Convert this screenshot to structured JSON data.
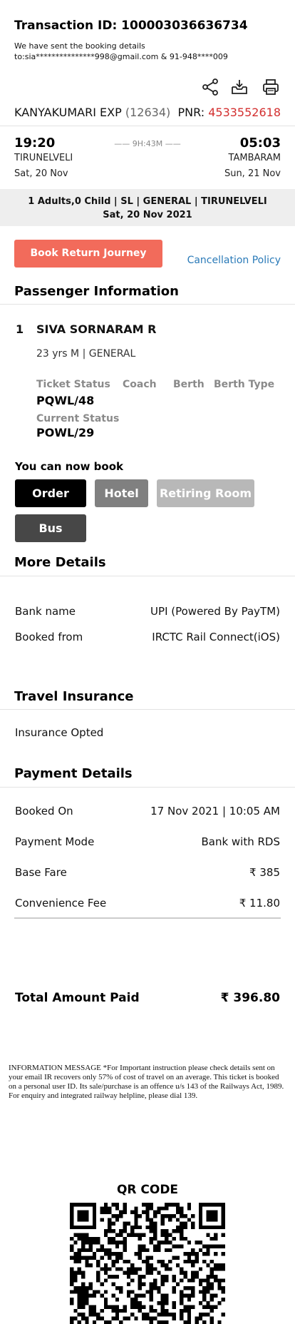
{
  "header": {
    "transaction_label": "Transaction ID: 100003036636734",
    "sent_line1": "We have sent the booking details",
    "sent_line2": "to:sia***************998@gmail.com & 91-948****009"
  },
  "actions": {
    "share_icon": "share-icon",
    "download_icon": "download-icon",
    "print_icon": "print-icon"
  },
  "train": {
    "name": "KANYAKUMARI EXP",
    "number": "(12634)",
    "pnr_label": "PNR: ",
    "pnr": "4533552618"
  },
  "journey": {
    "depart_time": "19:20",
    "arrive_time": "05:03",
    "duration": "—— 9H:43M ——",
    "from_station": "TIRUNELVELI",
    "to_station": "TAMBARAM",
    "depart_date": "Sat, 20 Nov",
    "arrive_date": "Sun, 21 Nov"
  },
  "summary": {
    "line1": "1 Adults,0 Child | SL | GENERAL | TIRUNELVELI",
    "line2": "Sat, 20 Nov 2021"
  },
  "buttons": {
    "book_return": "Book Return Journey",
    "cancellation_policy": "Cancellation Policy"
  },
  "passenger": {
    "section_title": "Passenger Information",
    "index": "1",
    "name": "SIVA SORNARAM R",
    "detail": "23 yrs M | GENERAL",
    "headers": [
      "Ticket Status",
      "Coach",
      "Berth",
      "Berth Type"
    ],
    "ticket_status": "PQWL/48",
    "current_status_label": "Current Status",
    "current_status": "POWL/29"
  },
  "booking_options": {
    "title": "You can now book",
    "order_food": "Order Food",
    "hotel": "Hotel",
    "retiring_room": "Retiring Room",
    "bus": "Bus"
  },
  "more_details": {
    "title": "More Details",
    "bank_label": "Bank name",
    "bank_value": "UPI (Powered By PayTM)",
    "booked_from_label": "Booked from",
    "booked_from_value": "IRCTC Rail Connect(iOS)"
  },
  "insurance": {
    "title": "Travel Insurance",
    "status": "Insurance Opted"
  },
  "payment": {
    "title": "Payment Details",
    "booked_on_label": "Booked On",
    "booked_on_value": "17 Nov 2021 | 10:05 AM",
    "mode_label": "Payment Mode",
    "mode_value": "Bank with RDS",
    "base_fare_label": "Base Fare",
    "base_fare_value": "₹ 385",
    "convenience_label": "Convenience Fee",
    "convenience_value": "₹ 11.80",
    "total_label": "Total Amount Paid",
    "total_value": "₹ 396.80"
  },
  "info_message": "INFORMATION MESSAGE *For Important instruction please check details sent on your email IR recovers only 57% of cost of travel on an average. This ticket is booked on a personal user ID. Its sale/purchase is an offence u/s 143 of the Railways Act, 1989. For enquiry and integrated railway helpline, please dial 139.",
  "qr": {
    "title": "QR CODE"
  },
  "colors": {
    "pnr": "#d32f2f",
    "book_return_button": "#f26b5b",
    "link": "#2a7ab8",
    "order_food_chip": "#000000",
    "hotel_chip": "#808080",
    "retiring_room_chip": "#b8b8b8",
    "bus_chip": "#474747"
  }
}
